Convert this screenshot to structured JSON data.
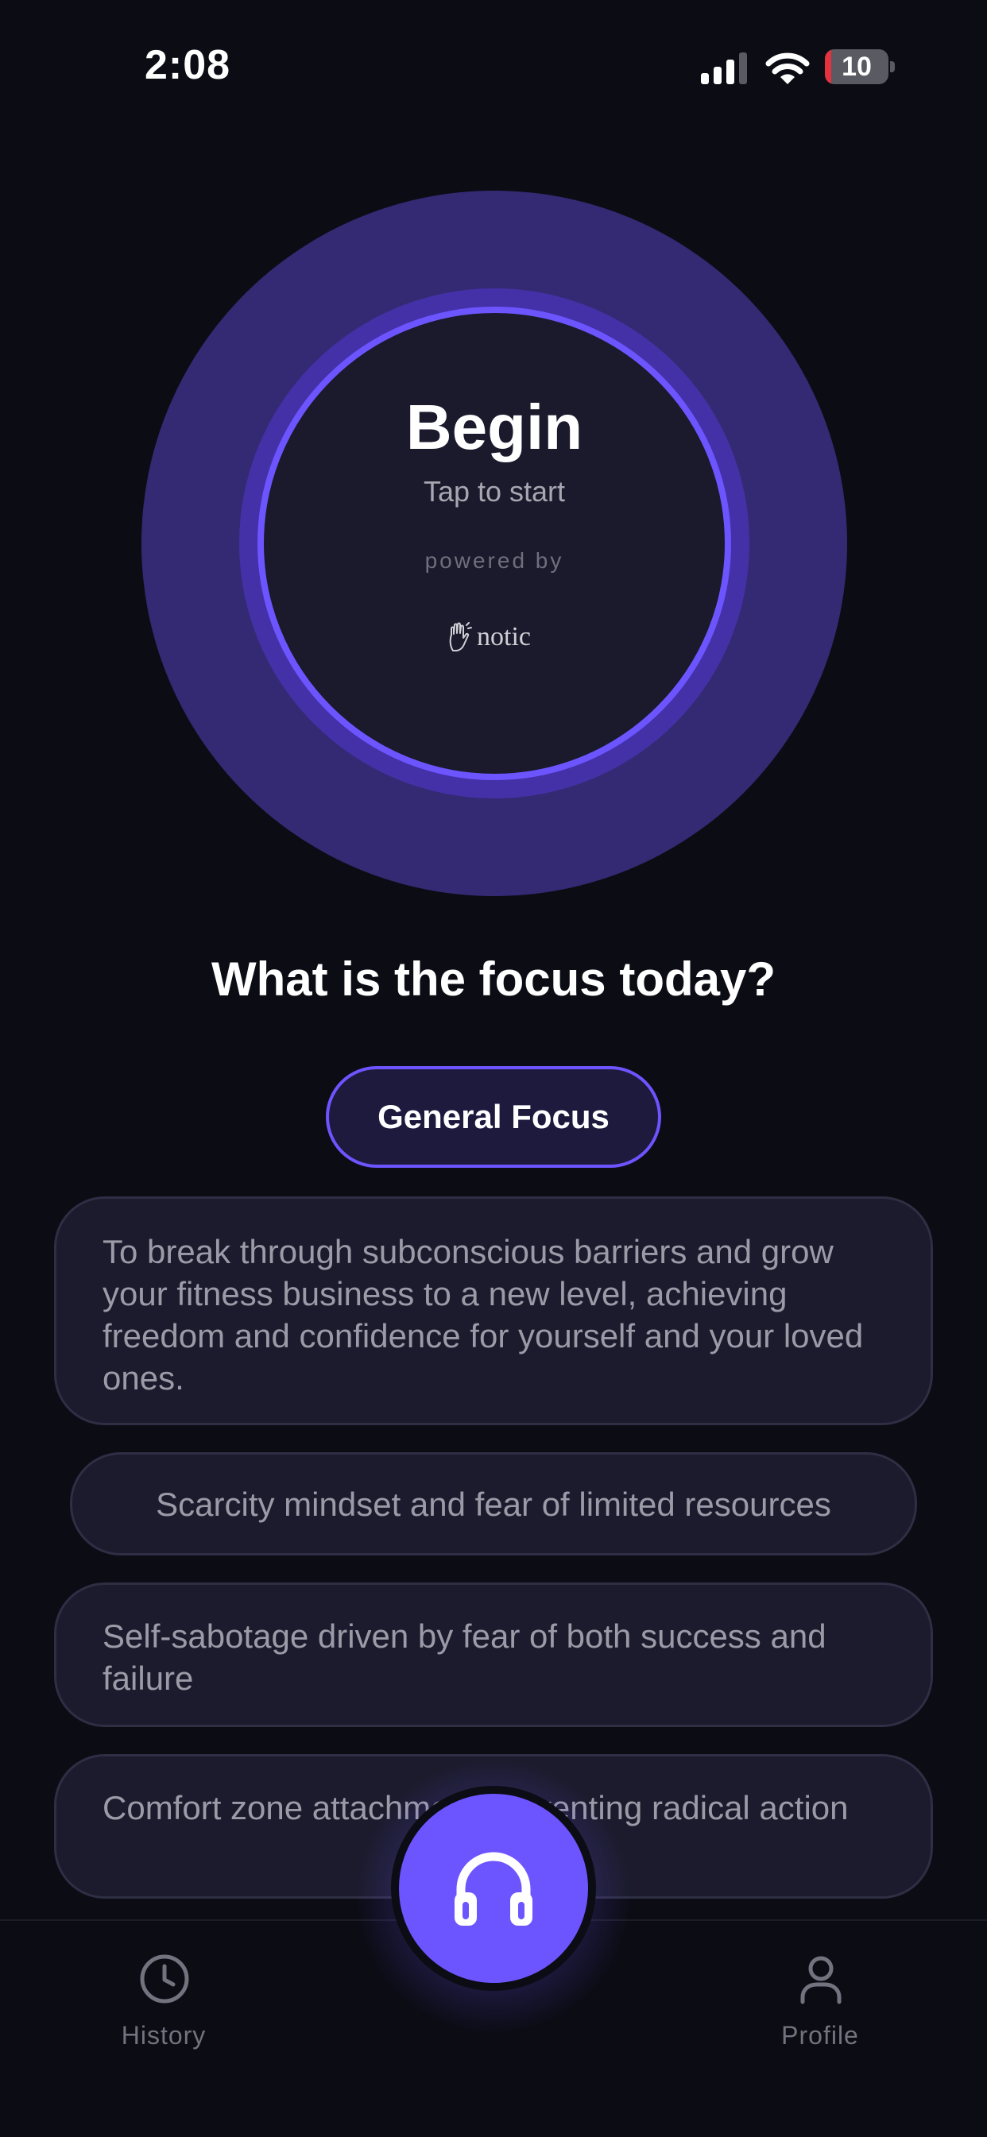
{
  "status_bar": {
    "time": "2:08",
    "battery_level": "10",
    "battery_fraction": 0.1,
    "battery_color": "#e5323f"
  },
  "orb": {
    "title": "Begin",
    "subtitle": "Tap to start",
    "powered_by": "powered by",
    "brand": "notic",
    "colors": {
      "outer": "#332a73",
      "ring": "#4431a8",
      "accent": "#6c55ff"
    }
  },
  "focus": {
    "question": "What is the focus today?",
    "selected": "General Focus",
    "options": [
      "To break through subconscious barriers and grow your fitness business to a new level, achieving freedom and confidence for yourself and your loved ones.",
      "Scarcity mindset and fear of limited resources",
      "Self-sabotage driven by fear of both success and failure",
      "Comfort zone attachment preventing radical action"
    ]
  },
  "tab_bar": {
    "history": "History",
    "profile": "Profile",
    "center_icon": "headphones-icon"
  }
}
